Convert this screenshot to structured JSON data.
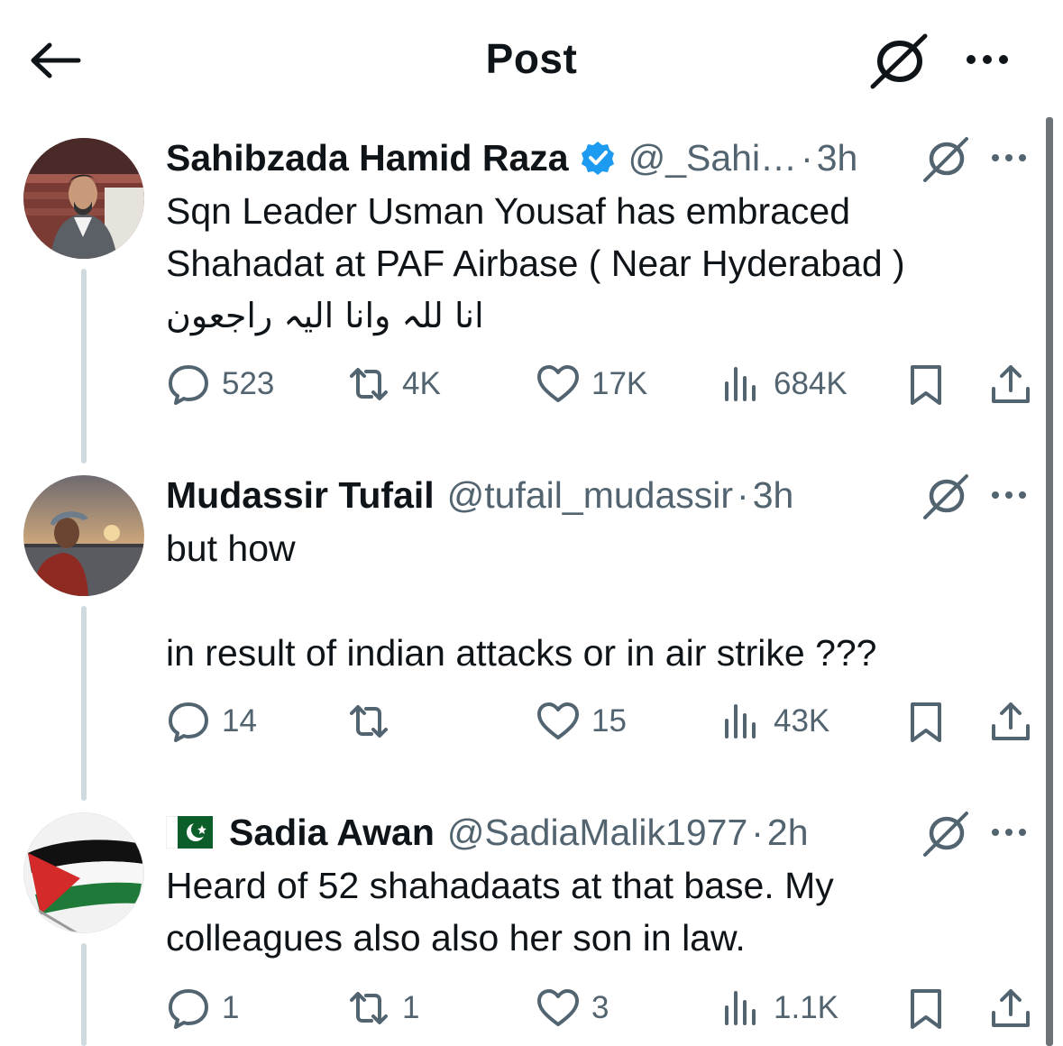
{
  "header": {
    "title": "Post"
  },
  "tweets": [
    {
      "name": "Sahibzada Hamid Raza",
      "handle": "@_Sahi…",
      "time": "3h",
      "verified": true,
      "flag": "",
      "lines": [
        "Sqn Leader Usman Yousaf has embraced",
        "Shahadat at PAF Airbase ( Near Hyderabad )",
        "انا للہ وانا الیہ راجعون"
      ],
      "replies": "523",
      "reposts": "4K",
      "likes": "17K",
      "views": "684K"
    },
    {
      "name": "Mudassir Tufail",
      "handle": "@tufail_mudassir",
      "time": "3h",
      "verified": false,
      "flag": "",
      "lines": [
        "but how",
        "",
        "in result of indian attacks or in air strike ???"
      ],
      "replies": "14",
      "reposts": "",
      "likes": "15",
      "views": "43K"
    },
    {
      "name": "Sadia Awan",
      "handle": "@SadiaMalik1977",
      "time": "2h",
      "verified": false,
      "flag": "pakistan-flag",
      "lines": [
        "Heard of 52 shahadaats at that base. My",
        "colleagues also also her son in law."
      ],
      "replies": "1",
      "reposts": "1",
      "likes": "3",
      "views": "1.1K"
    }
  ],
  "icons": {
    "back": "arrow-left-icon",
    "grok": "grok-icon",
    "more": "more-dots-icon",
    "reply": "reply-bubble-icon",
    "repost": "repost-icon",
    "like": "heart-icon",
    "views": "views-bars-icon",
    "bookmark": "bookmark-icon",
    "share": "share-icon",
    "verified": "verified-badge-icon"
  },
  "colors": {
    "text": "#0f1419",
    "secondary": "#536471",
    "verified": "#1d9bf0",
    "thread_line": "#cfd9de"
  }
}
